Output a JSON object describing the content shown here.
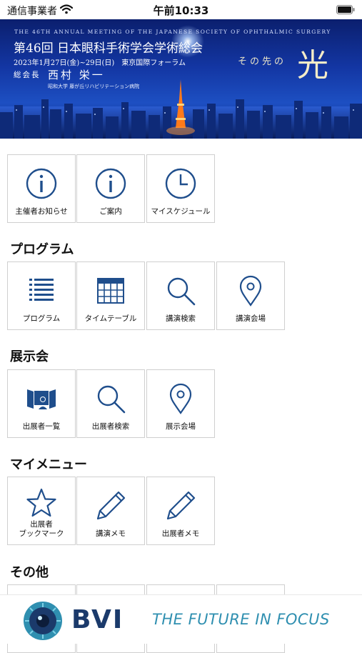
{
  "status_bar": {
    "carrier": "通信事業者",
    "time": "午前10:33"
  },
  "banner": {
    "english": "THE 46TH ANNUAL MEETING OF THE JAPANESE SOCIETY OF OPHTHALMIC SURGERY",
    "title": "第46回 日本眼科手術学会学術総会",
    "dates": "2023年1月27日(金)~29日(日)　東京国際フォーラム",
    "president_label": "総会長",
    "president_name": "西村 栄一",
    "affiliation": "昭和大学 藤が丘リハビリテーション病院",
    "tagline": "その先の",
    "hikari": "光"
  },
  "top_menu": [
    {
      "label": "主催者お知らせ",
      "icon": "info-icon"
    },
    {
      "label": "ご案内",
      "icon": "info-icon"
    },
    {
      "label": "マイスケジュール",
      "icon": "clock-icon"
    }
  ],
  "program": {
    "title": "プログラム",
    "items": [
      {
        "label": "プログラム",
        "icon": "list-icon"
      },
      {
        "label": "タイムテーブル",
        "icon": "calendar-icon"
      },
      {
        "label": "講演検索",
        "icon": "search-icon"
      },
      {
        "label": "講演会場",
        "icon": "location-pin-icon"
      }
    ]
  },
  "exhibition": {
    "title": "展示会",
    "items": [
      {
        "label": "出展者一覧",
        "icon": "exhibitor-board-icon"
      },
      {
        "label": "出展者検索",
        "icon": "search-icon"
      },
      {
        "label": "展示会場",
        "icon": "location-pin-icon"
      }
    ]
  },
  "my_menu": {
    "title": "マイメニュー",
    "items": [
      {
        "label_line1": "出展者",
        "label_line2": "ブックマーク",
        "icon": "star-icon"
      },
      {
        "label": "講演メモ",
        "icon": "pencil-icon"
      },
      {
        "label": "出展者メモ",
        "icon": "pencil-icon"
      }
    ]
  },
  "other": {
    "title": "その他"
  },
  "ad": {
    "brand": "BVI",
    "slogan": "THE FUTURE IN FOCUS",
    "accent": "#2f8fb0",
    "brand_color": "#1b3a6b"
  },
  "colors": {
    "icon_blue": "#1f4e8c",
    "tile_border": "#cfcfcf"
  }
}
